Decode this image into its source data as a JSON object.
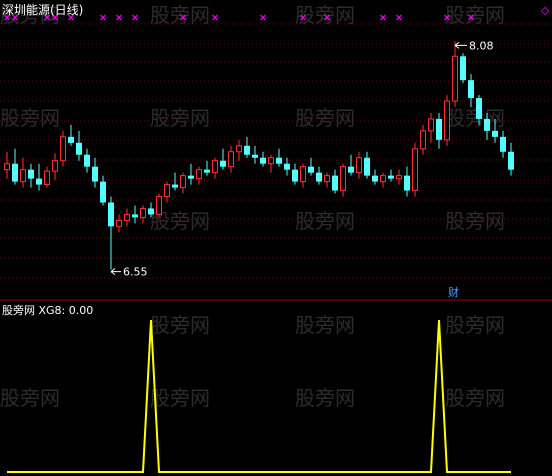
{
  "window": {
    "title": "深圳能源(日线)",
    "close_glyph": "◇"
  },
  "watermark": "股旁网",
  "badge": "财",
  "colors": {
    "background": "#000000",
    "up": "#ff3232",
    "down": "#54ffff",
    "grid": "#800000",
    "divider": "#a00000",
    "signal_mark": "#ff00ff",
    "indicator": "#ffff00",
    "label": "#ffffff",
    "badge": "#54a0ff"
  },
  "chart_data": [
    {
      "type": "candlestick",
      "title": "深圳能源(日线)",
      "high_annotation": "8.08",
      "low_annotation": "6.55",
      "ylim": [
        6.4,
        8.25
      ],
      "grid": true,
      "ohlc": [
        [
          7.22,
          7.34,
          7.16,
          7.26
        ],
        [
          7.26,
          7.36,
          7.12,
          7.14
        ],
        [
          7.14,
          7.3,
          7.1,
          7.22
        ],
        [
          7.22,
          7.26,
          7.1,
          7.16
        ],
        [
          7.16,
          7.26,
          7.08,
          7.12
        ],
        [
          7.12,
          7.24,
          7.1,
          7.21
        ],
        [
          7.21,
          7.33,
          7.15,
          7.28
        ],
        [
          7.28,
          7.48,
          7.24,
          7.44
        ],
        [
          7.44,
          7.52,
          7.38,
          7.4
        ],
        [
          7.4,
          7.48,
          7.28,
          7.32
        ],
        [
          7.32,
          7.36,
          7.2,
          7.24
        ],
        [
          7.24,
          7.3,
          7.1,
          7.14
        ],
        [
          7.14,
          7.18,
          6.98,
          7.0
        ],
        [
          7.0,
          7.04,
          6.55,
          6.84
        ],
        [
          6.84,
          6.92,
          6.8,
          6.88
        ],
        [
          6.88,
          6.96,
          6.84,
          6.92
        ],
        [
          6.92,
          6.98,
          6.86,
          6.9
        ],
        [
          6.9,
          6.98,
          6.86,
          6.96
        ],
        [
          6.96,
          7.0,
          6.9,
          6.92
        ],
        [
          6.92,
          7.06,
          6.9,
          7.04
        ],
        [
          7.04,
          7.14,
          7.0,
          7.12
        ],
        [
          7.12,
          7.2,
          7.08,
          7.1
        ],
        [
          7.1,
          7.2,
          7.06,
          7.18
        ],
        [
          7.18,
          7.26,
          7.12,
          7.16
        ],
        [
          7.16,
          7.24,
          7.12,
          7.22
        ],
        [
          7.22,
          7.28,
          7.18,
          7.2
        ],
        [
          7.2,
          7.3,
          7.16,
          7.28
        ],
        [
          7.28,
          7.36,
          7.22,
          7.24
        ],
        [
          7.24,
          7.38,
          7.2,
          7.34
        ],
        [
          7.34,
          7.42,
          7.28,
          7.38
        ],
        [
          7.38,
          7.44,
          7.3,
          7.32
        ],
        [
          7.32,
          7.38,
          7.26,
          7.3
        ],
        [
          7.3,
          7.34,
          7.24,
          7.26
        ],
        [
          7.26,
          7.32,
          7.2,
          7.3
        ],
        [
          7.3,
          7.36,
          7.24,
          7.26
        ],
        [
          7.26,
          7.3,
          7.18,
          7.22
        ],
        [
          7.22,
          7.26,
          7.12,
          7.14
        ],
        [
          7.14,
          7.26,
          7.1,
          7.24
        ],
        [
          7.24,
          7.3,
          7.18,
          7.2
        ],
        [
          7.2,
          7.24,
          7.12,
          7.14
        ],
        [
          7.14,
          7.2,
          7.1,
          7.18
        ],
        [
          7.18,
          7.22,
          7.06,
          7.08
        ],
        [
          7.08,
          7.26,
          7.04,
          7.24
        ],
        [
          7.24,
          7.32,
          7.18,
          7.2
        ],
        [
          7.2,
          7.34,
          7.16,
          7.3
        ],
        [
          7.3,
          7.34,
          7.16,
          7.18
        ],
        [
          7.18,
          7.22,
          7.12,
          7.14
        ],
        [
          7.14,
          7.2,
          7.1,
          7.18
        ],
        [
          7.18,
          7.22,
          7.14,
          7.16
        ],
        [
          7.16,
          7.22,
          7.12,
          7.18
        ],
        [
          7.18,
          7.24,
          7.04,
          7.08
        ],
        [
          7.08,
          7.4,
          7.04,
          7.36
        ],
        [
          7.36,
          7.52,
          7.32,
          7.48
        ],
        [
          7.48,
          7.6,
          7.4,
          7.56
        ],
        [
          7.56,
          7.6,
          7.36,
          7.42
        ],
        [
          7.42,
          7.72,
          7.38,
          7.68
        ],
        [
          7.68,
          8.08,
          7.64,
          7.98
        ],
        [
          7.98,
          8.0,
          7.8,
          7.82
        ],
        [
          7.82,
          7.86,
          7.64,
          7.7
        ],
        [
          7.7,
          7.72,
          7.52,
          7.56
        ],
        [
          7.56,
          7.6,
          7.42,
          7.48
        ],
        [
          7.48,
          7.56,
          7.4,
          7.44
        ],
        [
          7.44,
          7.48,
          7.3,
          7.34
        ],
        [
          7.34,
          7.4,
          7.18,
          7.22
        ]
      ],
      "signals": [
        0,
        1,
        5,
        6,
        8,
        12,
        14,
        16,
        22,
        26,
        32,
        37,
        40,
        47,
        49,
        55,
        58
      ]
    },
    {
      "type": "line",
      "title": "XG8: 0.00",
      "name": "XG8",
      "current_value": "0.00",
      "ylim": [
        0,
        1
      ],
      "values": [
        0,
        0,
        0,
        0,
        0,
        0,
        0,
        0,
        0,
        0,
        0,
        0,
        0,
        0,
        0,
        0,
        0,
        0,
        1,
        0,
        0,
        0,
        0,
        0,
        0,
        0,
        0,
        0,
        0,
        0,
        0,
        0,
        0,
        0,
        0,
        0,
        0,
        0,
        0,
        0,
        0,
        0,
        0,
        0,
        0,
        0,
        0,
        0,
        0,
        0,
        0,
        0,
        0,
        0,
        1,
        0,
        0,
        0,
        0,
        0,
        0,
        0,
        0,
        0
      ]
    }
  ]
}
